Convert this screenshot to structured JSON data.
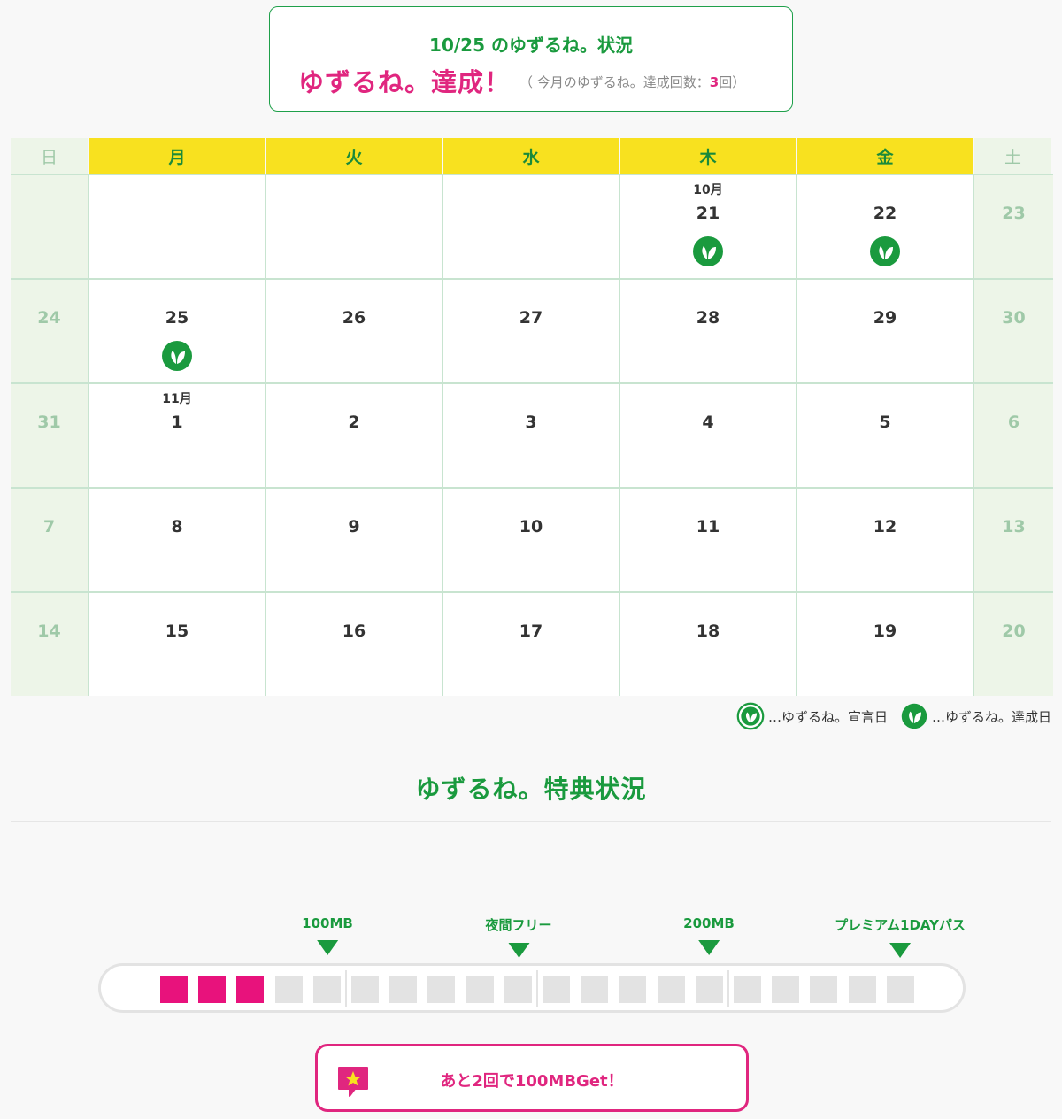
{
  "status": {
    "title": "10/25 のゆずるね。状況",
    "achieved": "ゆずるね。達成！",
    "note_prefix": "（ 今月のゆずるね。達成回数：",
    "count": "3",
    "note_suffix": "回）"
  },
  "calendar": {
    "headers": [
      "日",
      "月",
      "火",
      "水",
      "木",
      "金",
      "土"
    ],
    "weeks": [
      [
        {
          "num": "",
          "month": "",
          "mark": false
        },
        {
          "num": "",
          "month": "",
          "mark": false
        },
        {
          "num": "",
          "month": "",
          "mark": false
        },
        {
          "num": "",
          "month": "",
          "mark": false
        },
        {
          "num": "21",
          "month": "10月",
          "mark": true
        },
        {
          "num": "22",
          "month": "",
          "mark": true
        },
        {
          "num": "23",
          "month": "",
          "mark": false
        }
      ],
      [
        {
          "num": "24",
          "month": "",
          "mark": false
        },
        {
          "num": "25",
          "month": "",
          "mark": true
        },
        {
          "num": "26",
          "month": "",
          "mark": false
        },
        {
          "num": "27",
          "month": "",
          "mark": false
        },
        {
          "num": "28",
          "month": "",
          "mark": false
        },
        {
          "num": "29",
          "month": "",
          "mark": false
        },
        {
          "num": "30",
          "month": "",
          "mark": false
        }
      ],
      [
        {
          "num": "31",
          "month": "",
          "mark": false
        },
        {
          "num": "1",
          "month": "11月",
          "mark": false
        },
        {
          "num": "2",
          "month": "",
          "mark": false
        },
        {
          "num": "3",
          "month": "",
          "mark": false
        },
        {
          "num": "4",
          "month": "",
          "mark": false
        },
        {
          "num": "5",
          "month": "",
          "mark": false
        },
        {
          "num": "6",
          "month": "",
          "mark": false
        }
      ],
      [
        {
          "num": "7",
          "month": "",
          "mark": false
        },
        {
          "num": "8",
          "month": "",
          "mark": false
        },
        {
          "num": "9",
          "month": "",
          "mark": false
        },
        {
          "num": "10",
          "month": "",
          "mark": false
        },
        {
          "num": "11",
          "month": "",
          "mark": false
        },
        {
          "num": "12",
          "month": "",
          "mark": false
        },
        {
          "num": "13",
          "month": "",
          "mark": false
        }
      ],
      [
        {
          "num": "14",
          "month": "",
          "mark": false
        },
        {
          "num": "15",
          "month": "",
          "mark": false
        },
        {
          "num": "16",
          "month": "",
          "mark": false
        },
        {
          "num": "17",
          "month": "",
          "mark": false
        },
        {
          "num": "18",
          "month": "",
          "mark": false
        },
        {
          "num": "19",
          "month": "",
          "mark": false
        },
        {
          "num": "20",
          "month": "",
          "mark": false
        }
      ]
    ]
  },
  "legend": {
    "declared": "…ゆずるね。宣言日",
    "achieved": "…ゆずるね。達成日"
  },
  "benefits": {
    "title": "ゆずるね。特典状況",
    "milestones": [
      "100MB",
      "夜間フリー",
      "200MB",
      "プレミアム1DAYパス"
    ],
    "progress_filled": 3,
    "progress_total": 20,
    "next_message": "あと2回で100MBGet！"
  },
  "colors": {
    "accent_green": "#1a9a3e",
    "accent_pink": "#e0267f",
    "header_yellow": "#f8e11f"
  },
  "icons": {
    "mark": "sprout-leaf-icon",
    "bubble": "star-speech-bubble-icon"
  }
}
